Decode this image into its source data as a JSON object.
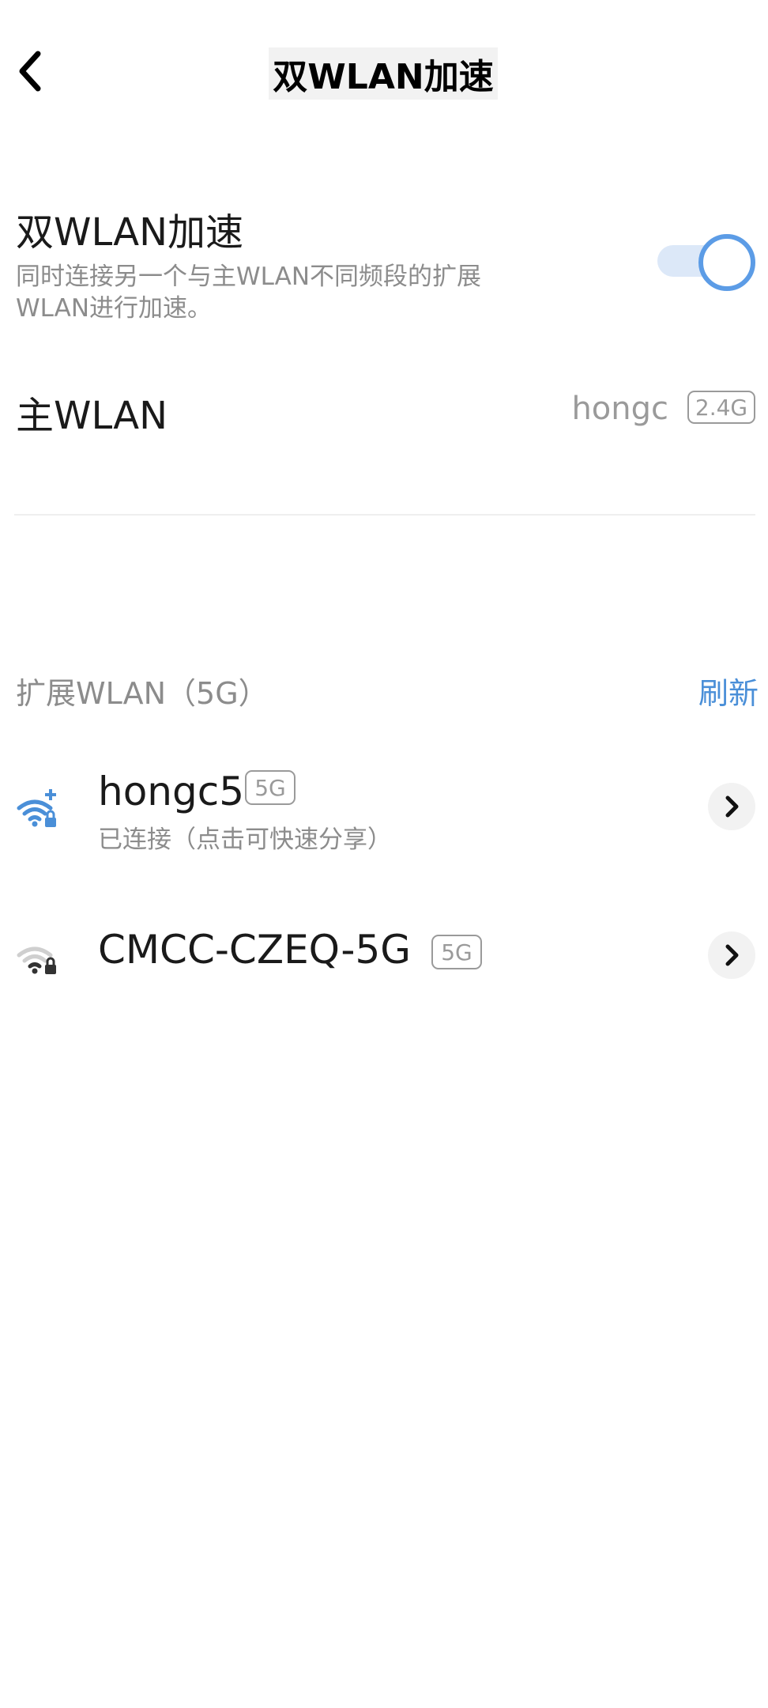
{
  "header": {
    "title": "双WLAN加速",
    "back_icon": "chevron-left-icon"
  },
  "dual_wlan": {
    "title": "双WLAN加速",
    "description": "同时连接另一个与主WLAN不同频段的扩展WLAN进行加速。",
    "toggle_on": true,
    "accent_color": "#5c9ce6"
  },
  "main_wlan": {
    "label": "主WLAN",
    "ssid": "hongc",
    "band": "2.4G"
  },
  "extended_wlan": {
    "label": "扩展WLAN（5G）",
    "refresh_label": "刷新",
    "networks": [
      {
        "ssid": "hongc5",
        "band": "5G",
        "status": "已连接（点击可快速分享）",
        "icon": "wifi-locked-connected-icon"
      },
      {
        "ssid": "CMCC-CZEQ-5G",
        "band": "5G",
        "icon": "wifi-locked-icon"
      }
    ]
  }
}
